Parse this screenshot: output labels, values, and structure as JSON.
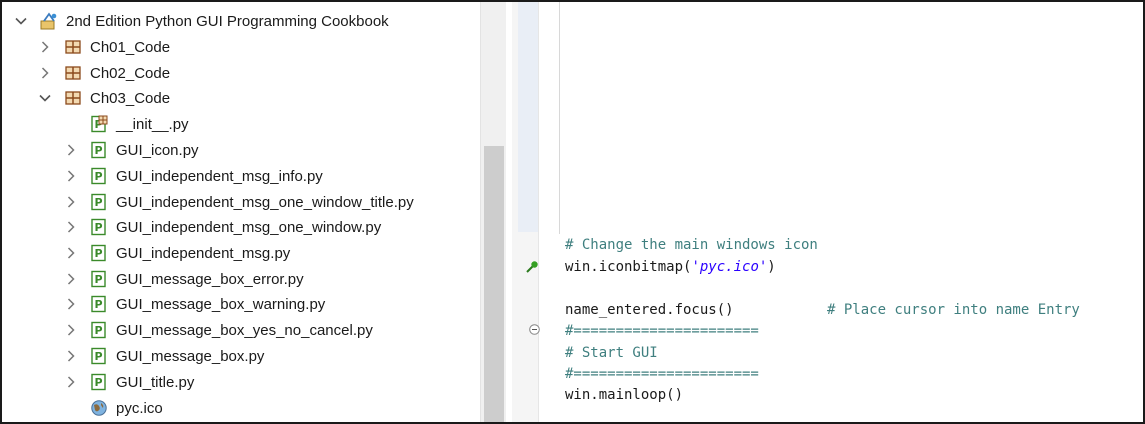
{
  "explorer": {
    "items": [
      {
        "label": "2nd Edition Python GUI Programming Cookbook",
        "icon": "project-icon",
        "chevron": "expanded"
      },
      {
        "label": "Ch01_Code",
        "icon": "package-icon",
        "chevron": "collapsed"
      },
      {
        "label": "Ch02_Code",
        "icon": "package-icon",
        "chevron": "collapsed"
      },
      {
        "label": "Ch03_Code",
        "icon": "package-icon",
        "chevron": "expanded"
      },
      {
        "label": "__init__.py",
        "icon": "init-py-file-icon",
        "chevron": "none"
      },
      {
        "label": "GUI_icon.py",
        "icon": "python-file-icon",
        "chevron": "collapsed"
      },
      {
        "label": "GUI_independent_msg_info.py",
        "icon": "python-file-icon",
        "chevron": "collapsed"
      },
      {
        "label": "GUI_independent_msg_one_window_title.py",
        "icon": "python-file-icon",
        "chevron": "collapsed"
      },
      {
        "label": "GUI_independent_msg_one_window.py",
        "icon": "python-file-icon",
        "chevron": "collapsed"
      },
      {
        "label": "GUI_independent_msg.py",
        "icon": "python-file-icon",
        "chevron": "collapsed"
      },
      {
        "label": "GUI_message_box_error.py",
        "icon": "python-file-icon",
        "chevron": "collapsed"
      },
      {
        "label": "GUI_message_box_warning.py",
        "icon": "python-file-icon",
        "chevron": "collapsed"
      },
      {
        "label": "GUI_message_box_yes_no_cancel.py",
        "icon": "python-file-icon",
        "chevron": "collapsed"
      },
      {
        "label": "GUI_message_box.py",
        "icon": "python-file-icon",
        "chevron": "collapsed"
      },
      {
        "label": "GUI_title.py",
        "icon": "python-file-icon",
        "chevron": "collapsed"
      },
      {
        "label": "pyc.ico",
        "icon": "globe-ico-file-icon",
        "chevron": "none"
      }
    ]
  },
  "editor": {
    "comment_change_icon": "# Change the main windows icon",
    "iconbitmap_call": "win.iconbitmap(",
    "iconbitmap_arg": "'pyc.ico'",
    "iconbitmap_close": ")",
    "focus_call": "name_entered.focus()",
    "focus_comment": "# Place cursor into name Entry",
    "separator_top": "#======================",
    "comment_start_gui": "# Start GUI",
    "separator_bottom": "#======================",
    "mainloop_call": "win.mainloop()"
  },
  "colors": {
    "comment": "#3f7f7f",
    "string": "#2a00ff",
    "python_icon_green": "#3a8a2a",
    "package_icon_brown": "#8b4a1c"
  }
}
